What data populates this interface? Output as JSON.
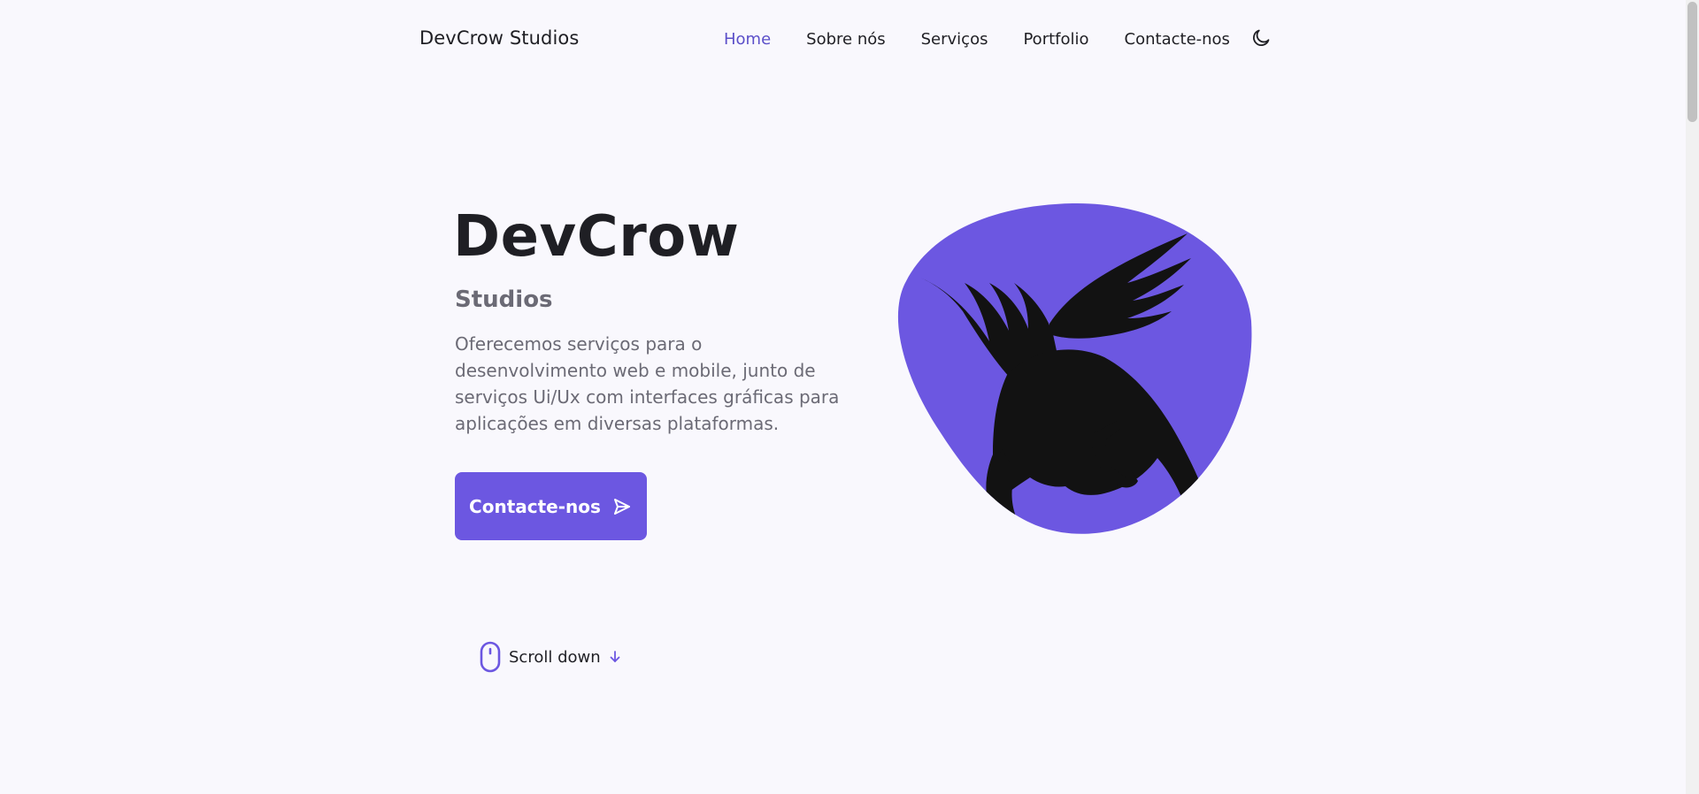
{
  "header": {
    "brand": "DevCrow Studios",
    "nav": [
      {
        "label": "Home",
        "active": true
      },
      {
        "label": "Sobre nós",
        "active": false
      },
      {
        "label": "Serviços",
        "active": false
      },
      {
        "label": "Portfolio",
        "active": false
      },
      {
        "label": "Contacte-nos",
        "active": false
      }
    ],
    "theme_toggle_icon": "moon-icon"
  },
  "hero": {
    "title": "DevCrow",
    "subtitle": "Studios",
    "description": "Oferecemos serviços para o desenvolvimento web e mobile, junto de serviços Ui/Ux com interfaces gráficas para aplicações em diversas plataformas.",
    "cta_label": "Contacte-nos",
    "cta_icon": "send-icon",
    "image_icon": "crow-logo"
  },
  "scroll": {
    "label": "Scroll down",
    "icons": [
      "mouse-icon",
      "arrow-down-icon"
    ]
  },
  "colors": {
    "accent": "#6c57e1",
    "background": "#f9f8fd",
    "text": "#1f1f24",
    "muted": "#6b6a75",
    "crow": "#121212"
  }
}
